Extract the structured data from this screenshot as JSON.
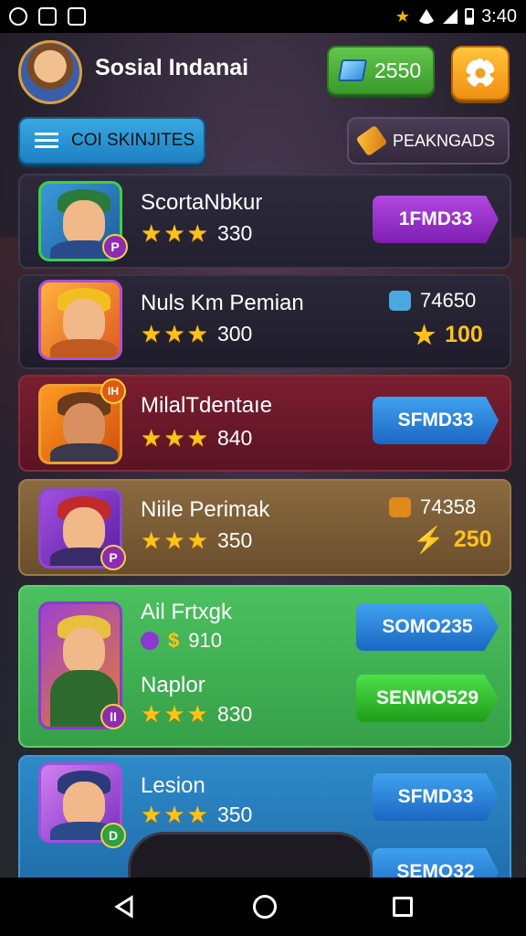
{
  "status_bar": {
    "time": "3:40"
  },
  "header": {
    "username": "Sosial Indanai",
    "currency_amount": "2550",
    "settings_icon": "gear-icon"
  },
  "tabs": {
    "left_label": "COI SKINJITES",
    "right_label": "PEAKNGADS"
  },
  "colors": {
    "accent_green": "#3a9a2a",
    "accent_orange": "#f08f12",
    "accent_blue": "#1d7fc2",
    "star_gold": "#ffc21a"
  },
  "cards": [
    {
      "name": "ScortaNbkur",
      "score": "330",
      "stars": 3,
      "button": "1FMD33"
    },
    {
      "name": "Nuls Km Pemian",
      "score": "300",
      "stars": 3,
      "stat_top": "74650",
      "stat_bottom": "100"
    },
    {
      "name": "MilalTdentaıe",
      "score": "840",
      "stars": 3,
      "button": "SFMD33",
      "badge": "IH"
    },
    {
      "name": "Niile Perimak",
      "score": "350",
      "stars": 3,
      "stat_top": "74358",
      "stat_bottom": "250"
    },
    {
      "name": "Ail Frtxgk",
      "sub_value": "910",
      "sub_currency": "$",
      "name2": "Naplor",
      "score": "830",
      "stars": 3,
      "button_top": "SOMO235",
      "button_bottom": "SENMO529"
    },
    {
      "name": "Lesion",
      "score": "350",
      "stars": 3,
      "button": "SFMD33",
      "button_peek": "SEMO32"
    }
  ]
}
